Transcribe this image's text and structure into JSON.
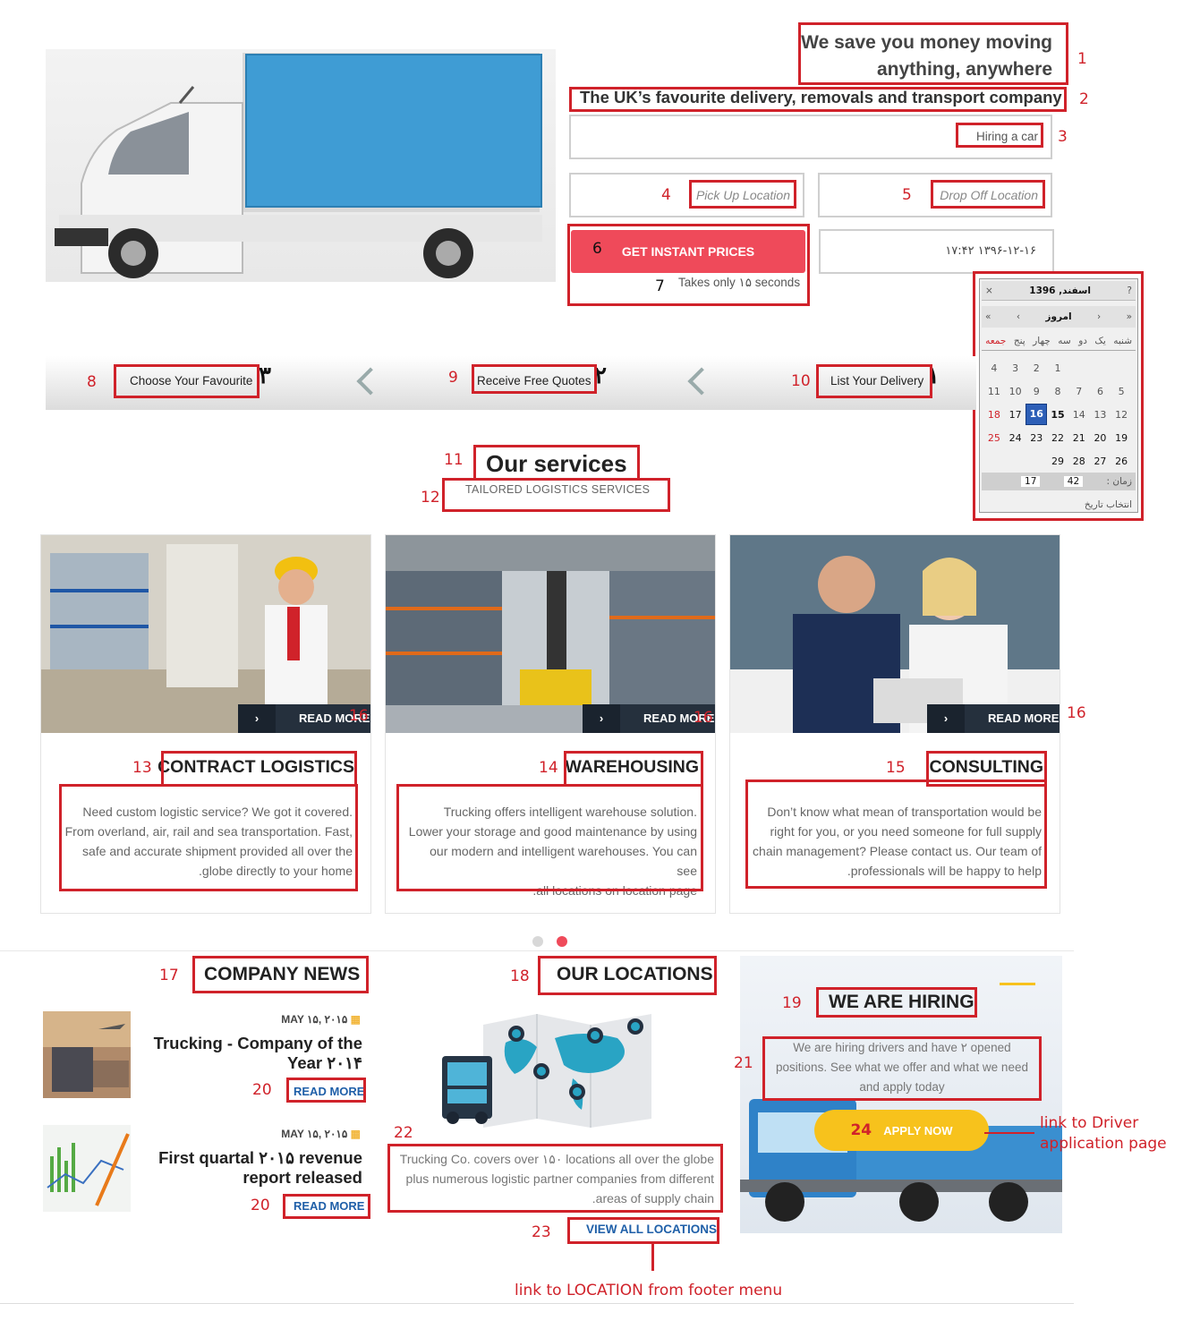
{
  "hero": {
    "title_line1": "We save you money moving",
    "title_line2": "anything, anywhere",
    "subtitle": "The UK’s favourite delivery, removals and transport company",
    "hiring_input_value": "Hiring a car",
    "pickup_placeholder": "Pick Up Location",
    "dropoff_placeholder": "Drop Off Location",
    "datetime_value": "۱۷:۴۲ ۱۳۹۶-۱۲-۱۶",
    "cta_label": "GET INSTANT PRICES",
    "cta_note": "Takes only ۱۵ seconds"
  },
  "calendar": {
    "help": "?",
    "month_year": "اسفند, 1396",
    "close": "×",
    "nav_prev_year": "«",
    "nav_prev": "‹",
    "today": "امروز",
    "nav_next": "›",
    "nav_next_year": "»",
    "weekdays": [
      "شنبه",
      "یک",
      "دو",
      "سه",
      "چهار",
      "پنج",
      "جمعه"
    ],
    "weeks": [
      [
        "",
        "",
        "",
        "1",
        "2",
        "3",
        "4"
      ],
      [
        "5",
        "6",
        "7",
        "8",
        "9",
        "10",
        "11"
      ],
      [
        "12",
        "13",
        "14",
        "15",
        "16",
        "17",
        "18"
      ],
      [
        "19",
        "20",
        "21",
        "22",
        "23",
        "24",
        "25"
      ],
      [
        "26",
        "27",
        "28",
        "29",
        "",
        "",
        ""
      ]
    ],
    "selected_day": "16",
    "time_label": "زمان :",
    "hour": "17",
    "minute": "42",
    "footer": "انتخاب تاریخ"
  },
  "steps": [
    {
      "label": "Choose Your Favourite",
      "number": "۳"
    },
    {
      "label": "Receive Free Quotes",
      "number": "۲"
    },
    {
      "label": "List Your Delivery",
      "number": "۱"
    }
  ],
  "services": {
    "title": "Our services",
    "subtitle": "TAILORED LOGISTICS SERVICES",
    "read_more": "READ MORE",
    "cards": [
      {
        "title": "CONTRACT LOGISTICS",
        "line1": "Need custom logistic service? We got it covered.",
        "line2": "From overland, air, rail and sea transportation. Fast,",
        "line3": "safe and accurate shipment provided all over the",
        "line4": ".globe directly to your home"
      },
      {
        "title": "WAREHOUSING",
        "line1": "Trucking offers intelligent warehouse solution.",
        "line2": "Lower your storage and good maintenance by using",
        "line3": "our modern and intelligent warehouses. You can see",
        "line4": ".all locations on location page"
      },
      {
        "title": "CONSULTING",
        "line1": "Don’t know what mean of transportation would be",
        "line2": "right for you, or you need someone for full supply",
        "line3": "chain management? Please contact us. Our team of",
        "line4": ".professionals will be happy to help"
      }
    ]
  },
  "news": {
    "title": "COMPANY NEWS",
    "items": [
      {
        "date": "MAY ۱۵, ۲۰۱۵",
        "title_line1": "Trucking - Company of the",
        "title_line2": "Year ۲۰۱۴",
        "link": "READ MORE"
      },
      {
        "date": "MAY ۱۵, ۲۰۱۵",
        "title_line1": "First quartal ۲۰۱۵ revenue",
        "title_line2": "report released",
        "link": "READ MORE"
      }
    ]
  },
  "locations": {
    "title": "OUR LOCATIONS",
    "line1": "Trucking Co. covers over ۱۵۰ locations all over the globe",
    "line2": "plus numerous logistic partner companies from different",
    "line3": ".areas of supply chain",
    "link": "VIEW ALL LOCATIONS"
  },
  "hiring": {
    "title": "WE ARE HIRING",
    "line1": "We are hiring drivers and have ۲ opened",
    "line2": "positions. See what we offer and what we need",
    "line3": "and apply today",
    "cta": "APPLY NOW"
  },
  "annotations": {
    "n1": "1",
    "n2": "2",
    "n3": "3",
    "n4": "4",
    "n5": "5",
    "n6": "6",
    "n7": "7",
    "n8": "8",
    "n9": "9",
    "n10": "10",
    "n11": "11",
    "n12": "12",
    "n13": "13",
    "n14": "14",
    "n15": "15",
    "n16": "16",
    "n17": "17",
    "n18": "18",
    "n19": "19",
    "n20": "20",
    "n21": "21",
    "n22": "22",
    "n23": "23",
    "n24": "24",
    "driver_note_line1": "link to Driver",
    "driver_note_line2": "application page",
    "location_note": "link to LOCATION from footer menu"
  },
  "colors": {
    "accent_red": "#ef4a5a",
    "annotation_red": "#d0222a",
    "dark_bar": "#25303d",
    "link_blue": "#1f5fa8",
    "apply_yellow": "#f7c21c",
    "calendar_selected": "#2d5fb7"
  }
}
